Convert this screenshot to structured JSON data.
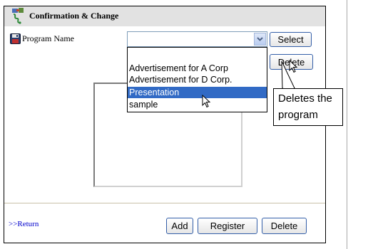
{
  "header": {
    "title": "Confirmation & Change"
  },
  "program": {
    "label": "Program Name",
    "selected_value": "",
    "select_button": "Select",
    "delete_button": "Delete"
  },
  "dropdown": {
    "options": [
      "Advertisement for A Corp",
      "Advertisement for D Corp.",
      "Presentation",
      "sample"
    ],
    "selected": "Presentation"
  },
  "callout": {
    "line1": "Deletes the",
    "line2": "program"
  },
  "footer": {
    "return_link": ">>Return",
    "add_button": "Add",
    "register_button": "Register",
    "delete_button": "Delete"
  }
}
